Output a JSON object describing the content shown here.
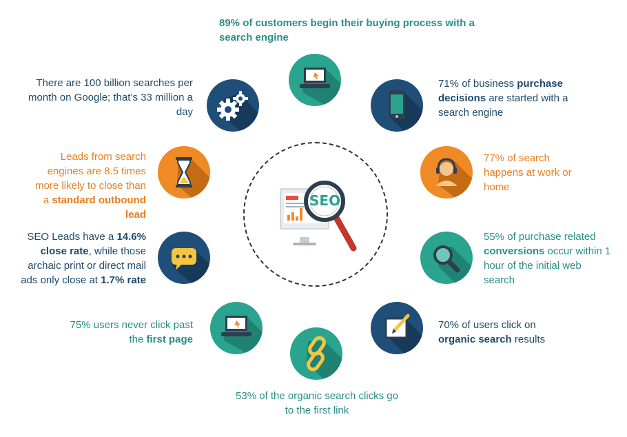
{
  "colors": {
    "teal": "#2aa38f",
    "navy": "#1f4e79",
    "orange": "#f08a24",
    "teal_text": "#2a8e8a",
    "navy_text": "#1e4a6b",
    "orange_text": "#e67e22"
  },
  "center": {
    "logo_text": "SEO",
    "icons": [
      "monitor-icon",
      "magnifier-icon"
    ]
  },
  "stats": {
    "s1": {
      "pre": "89% of customers begin their buying process with a search engine",
      "icon": "laptop-icon"
    },
    "s2": {
      "pre": "There are 100 billion searches per month on Google; that’s 33 million a day",
      "icon": "gears-icon"
    },
    "s3": {
      "pre": "71% of business ",
      "bold": "purchase decisions",
      "post": " are started with a search engine",
      "icon": "smartphone-icon"
    },
    "s4": {
      "pre": "Leads from search engines are 8.5 times more likely to close than a ",
      "bold": "standard outbound lead",
      "icon": "hourglass-icon"
    },
    "s5": {
      "pre": "77% of search happens at work or home",
      "icon": "headset-person-icon"
    },
    "s6": {
      "pre": "SEO Leads have a ",
      "bold1": "14.6% close rate",
      "mid": ", while those archaic print or direct mail ads only close at ",
      "bold2": "1.7% rate",
      "icon": "chat-bubble-icon"
    },
    "s7": {
      "pre": "55% of purchase related ",
      "bold": "conversions",
      "post": " occur within 1 hour of the initial web search",
      "icon": "search-icon"
    },
    "s8": {
      "pre": "75% users never click past the ",
      "bold": "first page",
      "icon": "laptop-icon"
    },
    "s9": {
      "pre": "70% of users click on ",
      "bold": "organic search",
      "post": " results",
      "icon": "edit-icon"
    },
    "s10": {
      "pre": "53% of the organic search clicks go to the first link",
      "icon": "link-icon"
    }
  }
}
